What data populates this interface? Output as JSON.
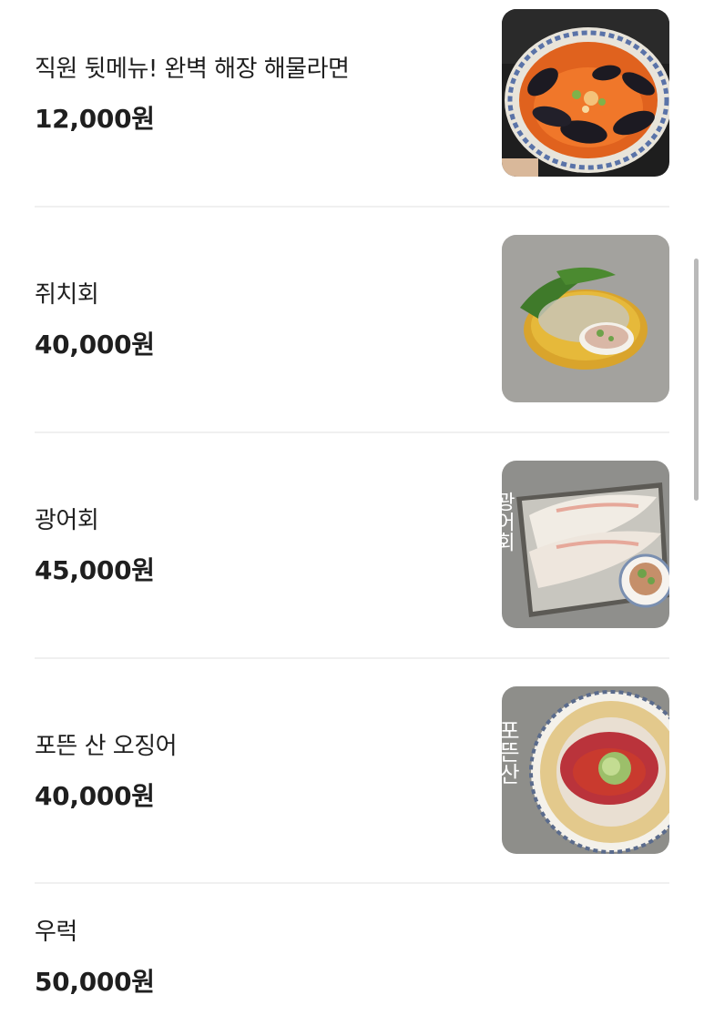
{
  "menu": {
    "items": [
      {
        "name": "직원 뒷메뉴! 완벽 해장 해물라면",
        "price": "12,000원",
        "image": "seafood-ramen-photo"
      },
      {
        "name": "쥐치회",
        "price": "40,000원",
        "image": "filefish-sashimi-photo"
      },
      {
        "name": "광어회",
        "price": "45,000원",
        "image": "flatfish-sashimi-photo",
        "image_text": "광어회"
      },
      {
        "name": "포뜬 산 오징어",
        "price": "40,000원",
        "image": "live-squid-photo",
        "image_text": "포뜬산"
      },
      {
        "name": "우럭",
        "price": "50,000원"
      }
    ]
  },
  "colors": {
    "text": "#1f1f1f",
    "divider": "#f0f0f0",
    "scrollbar": "#b9b9b9"
  }
}
